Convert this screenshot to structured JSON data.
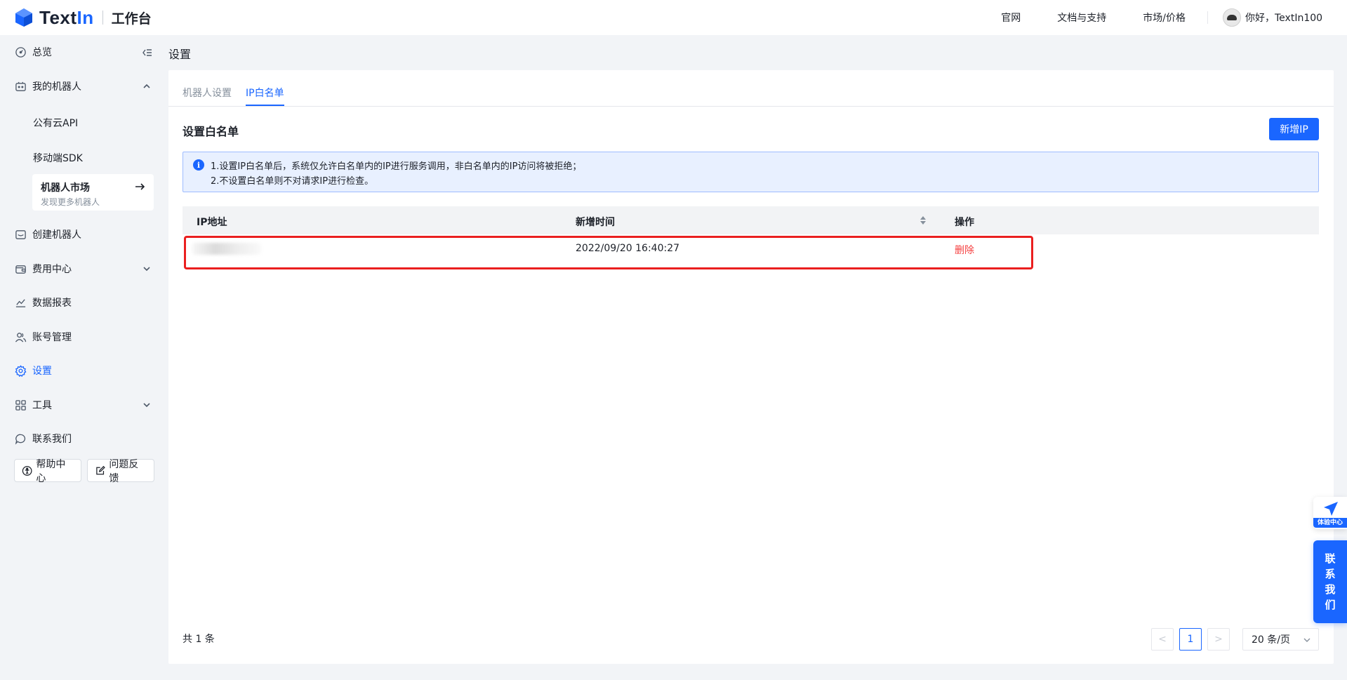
{
  "header": {
    "logo_text": "TextIn",
    "logo_sub": "工作台",
    "nav": [
      "官网",
      "文档与支持",
      "市场/价格"
    ],
    "user_greeting": "你好，TextIn100"
  },
  "sidebar": {
    "items": [
      {
        "label": "总览",
        "icon": "dashboard-icon"
      },
      {
        "label": "我的机器人",
        "icon": "robot-icon"
      },
      {
        "label": "创建机器人",
        "icon": "create-robot-icon"
      },
      {
        "label": "费用中心",
        "icon": "wallet-icon"
      },
      {
        "label": "数据报表",
        "icon": "chart-icon"
      },
      {
        "label": "账号管理",
        "icon": "users-icon"
      },
      {
        "label": "设置",
        "icon": "gear-icon"
      },
      {
        "label": "工具",
        "icon": "grid-icon"
      },
      {
        "label": "联系我们",
        "icon": "chat-icon"
      }
    ],
    "sub_items": [
      "公有云API",
      "移动端SDK"
    ],
    "market": {
      "title": "机器人市场",
      "subtitle": "发现更多机器人"
    },
    "help_label": "帮助中心",
    "feedback_label": "问题反馈"
  },
  "page": {
    "title": "设置",
    "tabs": [
      "机器人设置",
      "IP白名单"
    ],
    "active_tab": "IP白名单",
    "section_title": "设置白名单",
    "add_button": "新增IP",
    "alert_lines": [
      "1.设置IP白名单后，系统仅允许白名单内的IP进行服务调用，非白名单内的IP访问将被拒绝；",
      "2.不设置白名单则不对请求IP进行检查。"
    ],
    "table": {
      "columns": [
        "IP地址",
        "新增时间",
        "操作"
      ],
      "rows": [
        {
          "ip": "",
          "time": "2022/09/20 16:40:27",
          "action": "删除"
        }
      ]
    },
    "total": "共 1 条",
    "pager": {
      "prev": "<",
      "current": "1",
      "next": ">",
      "page_size": "20 条/页"
    }
  },
  "floating": {
    "experience_label": "体验中心",
    "contact_chars": [
      "联",
      "系",
      "我",
      "们"
    ]
  },
  "colors": {
    "accent": "#1a66ff",
    "danger": "#f53f3f",
    "highlight": "#ea1f1f"
  }
}
